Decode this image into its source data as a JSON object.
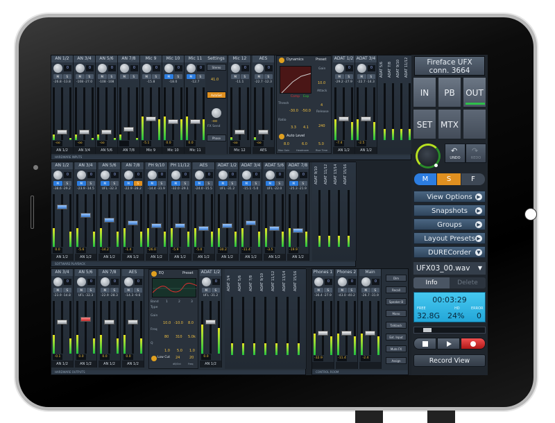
{
  "device": {
    "interface_name_line1": "Fireface UFX",
    "interface_name_line2": "conn. 3664"
  },
  "nav": {
    "in": "IN",
    "pb": "PB",
    "out": "OUT",
    "set": "SET",
    "mtx": "MTX",
    "undo": "UNDO",
    "redo": "REDO"
  },
  "mode": {
    "m": "M",
    "s": "S",
    "f": "F"
  },
  "menu": {
    "view_options": "View Options",
    "snapshots": "Snapshots",
    "groups": "Groups",
    "layout_presets": "Layout Presets",
    "durecorder": "DURECorder"
  },
  "recorder": {
    "file": "UFX03_00.wav",
    "info": "Info",
    "delete": "Delete",
    "time": "00:03:29",
    "free_label": "FREE",
    "hd_label": "HD",
    "error_label": "ERROR",
    "free_value": "32.8G",
    "hd_value": "24%",
    "error_value": "0",
    "position": 0.12,
    "record_view": "Record View"
  },
  "inputs": {
    "channels": [
      {
        "name": "AN 1/2",
        "level": "-26.8 -13.8",
        "foot": "AN 1/2",
        "val": "-oo"
      },
      {
        "name": "AN 3/4",
        "level": "-108 -27.0",
        "foot": "AN 3/4",
        "val": "-oo"
      },
      {
        "name": "AN 5/6",
        "level": "-108 -108",
        "foot": "AN 5/6",
        "val": "-oo"
      },
      {
        "name": "AN 7/8",
        "level": "",
        "foot": "AN 7/8",
        "val": ""
      },
      {
        "name": "Mic 9",
        "level": "-15.8",
        "foot": "Mic 9",
        "val": "-5.1"
      },
      {
        "name": "Mic 10",
        "level": "-18.0",
        "foot": "Mic 10",
        "val": "0.0"
      },
      {
        "name": "Mic 11",
        "level": "-12.7",
        "foot": "Mic 11",
        "val": "0.0"
      }
    ],
    "settings": {
      "title": "Settings",
      "stereo": "Stereo",
      "value": "41.0",
      "fx_send": "FX Send",
      "fx_value": "-oo",
      "phase": "Phase",
      "autoset": "AutoSet"
    },
    "channels_b": [
      {
        "name": "Mic 12",
        "level": "-11.1",
        "foot": "Mic 12",
        "val": "-oo"
      },
      {
        "name": "AES",
        "level": "-22.7 -12.3",
        "foot": "AES",
        "val": "-oo"
      }
    ],
    "dynamics": {
      "title": "Dynamics",
      "preset": "Preset",
      "gain_label": "Gain",
      "gain": "10.0",
      "thresh_label": "Thresh",
      "thresh_a": "-30.0",
      "thresh_b": "-50.0",
      "ratio_label": "Ratio",
      "ratio_a": "3.3",
      "ratio_b": "4.1",
      "attack_label": "Attack",
      "attack": "4",
      "release_label": "Release",
      "release": "240",
      "autolevel": "Auto Level",
      "maxgain_label": "Max Gain",
      "maxgain": "8.0",
      "headroom_label": "Headroom",
      "headroom": "6.0",
      "risetime_label": "Rise Time",
      "risetime": "5.0",
      "comp_label": "Comp",
      "exp_label": "Exp"
    },
    "channels_c": [
      {
        "name": "ADAT 1/2",
        "level": "-29.2 -27.9",
        "foot": "AN 1/2",
        "val": "-7.4"
      },
      {
        "name": "ADAT 3/4",
        "level": "-22.7 -14.3",
        "foot": "AN 1/2",
        "val": "-2.5"
      }
    ],
    "minis": [
      "ADAT 5/6",
      "ADAT 7/8",
      "ADAT 9/10",
      "ADAT 11/12"
    ],
    "section_label": "HARDWARE INPUTS"
  },
  "playback": {
    "channels": [
      {
        "name": "AN 1/2",
        "level": "-38.6 -29.2",
        "foot": "AN 1/2",
        "val": "0.0"
      },
      {
        "name": "AN 3/4",
        "level": "-23.9 -14.5",
        "foot": "AN 1/2",
        "val": "-5.6"
      },
      {
        "name": "AN 5/6",
        "level": "UFL -32.3",
        "foot": "AN 1/2",
        "val": "-14.2"
      },
      {
        "name": "AN 7/8",
        "level": "-22.9 -28.2",
        "foot": "AN 1/2",
        "val": "-1.4"
      },
      {
        "name": "PH 9/10",
        "level": "-14.4 -31.9",
        "foot": "AN 1/2",
        "val": "-26.0"
      },
      {
        "name": "PH 11/12",
        "level": "-32.0 -29.1",
        "foot": "AN 1/2",
        "val": "-5.9"
      },
      {
        "name": "AES",
        "level": "-24.0 -15.5",
        "foot": "AN 1/2",
        "val": "-5.0"
      },
      {
        "name": "ADAT 1/2",
        "level": "UFL -31.2",
        "foot": "AN 1/2",
        "val": "-30.2"
      },
      {
        "name": "ADAT 3/4",
        "level": "-15.1 -5.0",
        "foot": "AN 1/2",
        "val": "-11.4"
      },
      {
        "name": "ADAT 5/6",
        "level": "UFL -22.0",
        "foot": "AN 1/2",
        "val": "-3.5"
      },
      {
        "name": "ADAT 7/8",
        "level": "-25.3 -21.9",
        "foot": "AN 1/2",
        "val": "-19.9"
      }
    ],
    "minis": [
      "ADAT 9/10",
      "ADAT 11/12",
      "ADAT 13/14",
      "ADAT 15/16"
    ],
    "section_label": "SOFTWARE PLAYBACK"
  },
  "outputs": {
    "channels": [
      {
        "name": "AN 3/4",
        "level": "-23.9 -14.8",
        "foot": "AN 1/2",
        "val": "-0.1"
      },
      {
        "name": "AN 5/6",
        "level": "UFL -32.3",
        "foot": "AN 1/2",
        "val": "0.0"
      },
      {
        "name": "AN 7/8",
        "level": "-22.9 -28.3",
        "foot": "AN 1/2",
        "val": "0.0"
      },
      {
        "name": "AES",
        "level": "-14.3 -9.6",
        "foot": "AN 1/2",
        "val": "0.0"
      }
    ],
    "eq": {
      "title": "EQ",
      "preset": "Preset",
      "band_label": "Band",
      "type_label": "Type",
      "gain_label": "Gain",
      "freq_label": "Freq",
      "q_label": "Q",
      "band1": "1",
      "band2": "2",
      "band3": "3",
      "gain": [
        "10.0",
        "-10.0",
        "8.0"
      ],
      "freq": [
        "80",
        "310",
        "5.0k"
      ],
      "q": [
        "1.0",
        "5.0",
        "1.0"
      ],
      "lowcut": "Low Cut",
      "lowcut_val": "24",
      "lowcut_freq": "20",
      "lowcut_unit_a": "dB/Oct",
      "lowcut_unit_b": "Freq"
    },
    "channels_b": [
      {
        "name": "ADAT 1/2",
        "level": "UFL -31.2",
        "foot": "AN 1/2",
        "val": "0.0"
      }
    ],
    "minis": [
      "ADAT 3/4",
      "ADAT 5/6",
      "ADAT 7/8",
      "ADAT 9/10",
      "ADAT 11/12",
      "ADAT 13/14",
      "ADAT 15/16"
    ],
    "section_label": "HARDWARE OUTPUTS"
  },
  "control_room": {
    "phones1": {
      "name": "Phones 1",
      "level": "-36.4 -27.9",
      "val": "-32.9"
    },
    "phones2": {
      "name": "Phones 2",
      "level": "-43.0 -40.2",
      "val": "-11.4"
    },
    "main": {
      "name": "Main",
      "level": "-26.7 -31.9",
      "val": "-2.4"
    },
    "buttons": [
      "Dim",
      "Recall",
      "Speaker B",
      "Mono",
      "Talkback",
      "Ext. Input",
      "Mute FX",
      "Assign"
    ],
    "section_label": "CONTROL ROOM"
  },
  "colors": {
    "accent_blue": "#2c7de0",
    "solo_orange": "#e09020",
    "meter_green": "#20c040",
    "lcd_cyan": "#2ab4e4",
    "rec_red": "#d02828"
  }
}
